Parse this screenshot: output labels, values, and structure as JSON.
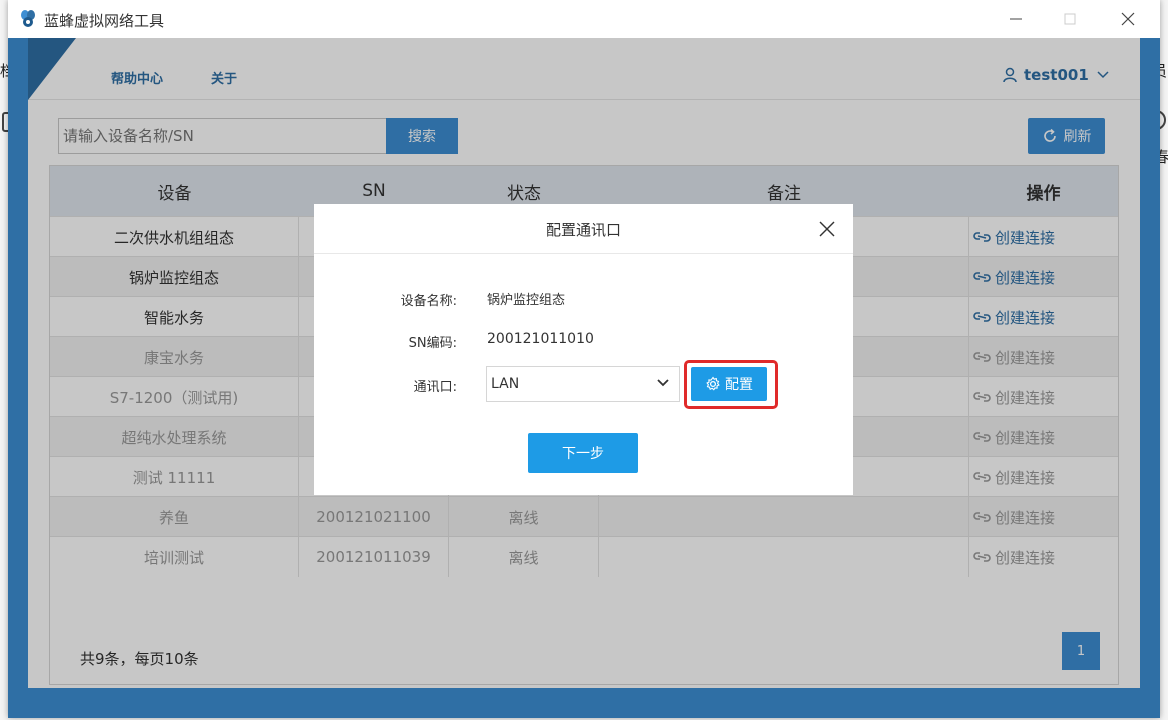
{
  "background": {
    "left_fragment": "档",
    "right_fragment_top": "员",
    "right_fragment_bottom": "春"
  },
  "window": {
    "title": "蓝蜂虚拟网络工具"
  },
  "header": {
    "nav": [
      "帮助中心",
      "关于"
    ],
    "user": "test001"
  },
  "toolbar": {
    "search_placeholder": "请输入设备名称/SN",
    "search_label": "搜索",
    "refresh_label": "刷新"
  },
  "table": {
    "columns": [
      "设备",
      "SN",
      "状态",
      "备注",
      "操作"
    ],
    "rows": [
      {
        "device": "二次供水机组组态",
        "sn": "",
        "status": "",
        "note": "",
        "action": "创建连接",
        "online": true
      },
      {
        "device": "锅炉监控组态",
        "sn": "",
        "status": "",
        "note": "",
        "action": "创建连接",
        "online": true
      },
      {
        "device": "智能水务",
        "sn": "",
        "status": "",
        "note": "",
        "action": "创建连接",
        "online": true
      },
      {
        "device": "康宝水务",
        "sn": "",
        "status": "",
        "note": "",
        "action": "创建连接",
        "online": false
      },
      {
        "device": "S7-1200（测试用)",
        "sn": "",
        "status": "",
        "note": "",
        "action": "创建连接",
        "online": false
      },
      {
        "device": "超纯水处理系统",
        "sn": "",
        "status": "",
        "note": "",
        "action": "创建连接",
        "online": false
      },
      {
        "device": "测试 11111",
        "sn": "",
        "status": "",
        "note": "",
        "action": "创建连接",
        "online": false
      },
      {
        "device": "养鱼",
        "sn": "200121021100",
        "status": "离线",
        "note": "",
        "action": "创建连接",
        "online": false
      },
      {
        "device": "培训测试",
        "sn": "200121011039",
        "status": "离线",
        "note": "",
        "action": "创建连接",
        "online": false
      }
    ]
  },
  "pagination": {
    "summary": "共9条，每页10条",
    "current_page": "1"
  },
  "modal": {
    "title": "配置通讯口",
    "device_name_label": "设备名称:",
    "device_name": "锅炉监控组态",
    "sn_label": "SN编码:",
    "sn": "200121011010",
    "port_label": "通讯口:",
    "port_value": "LAN",
    "config_label": "配置",
    "next_label": "下一步"
  },
  "colors": {
    "primary": "#2f6fa5",
    "button": "#3d8ed3",
    "modal_button": "#1e9be6",
    "highlight": "#e02a2a"
  }
}
